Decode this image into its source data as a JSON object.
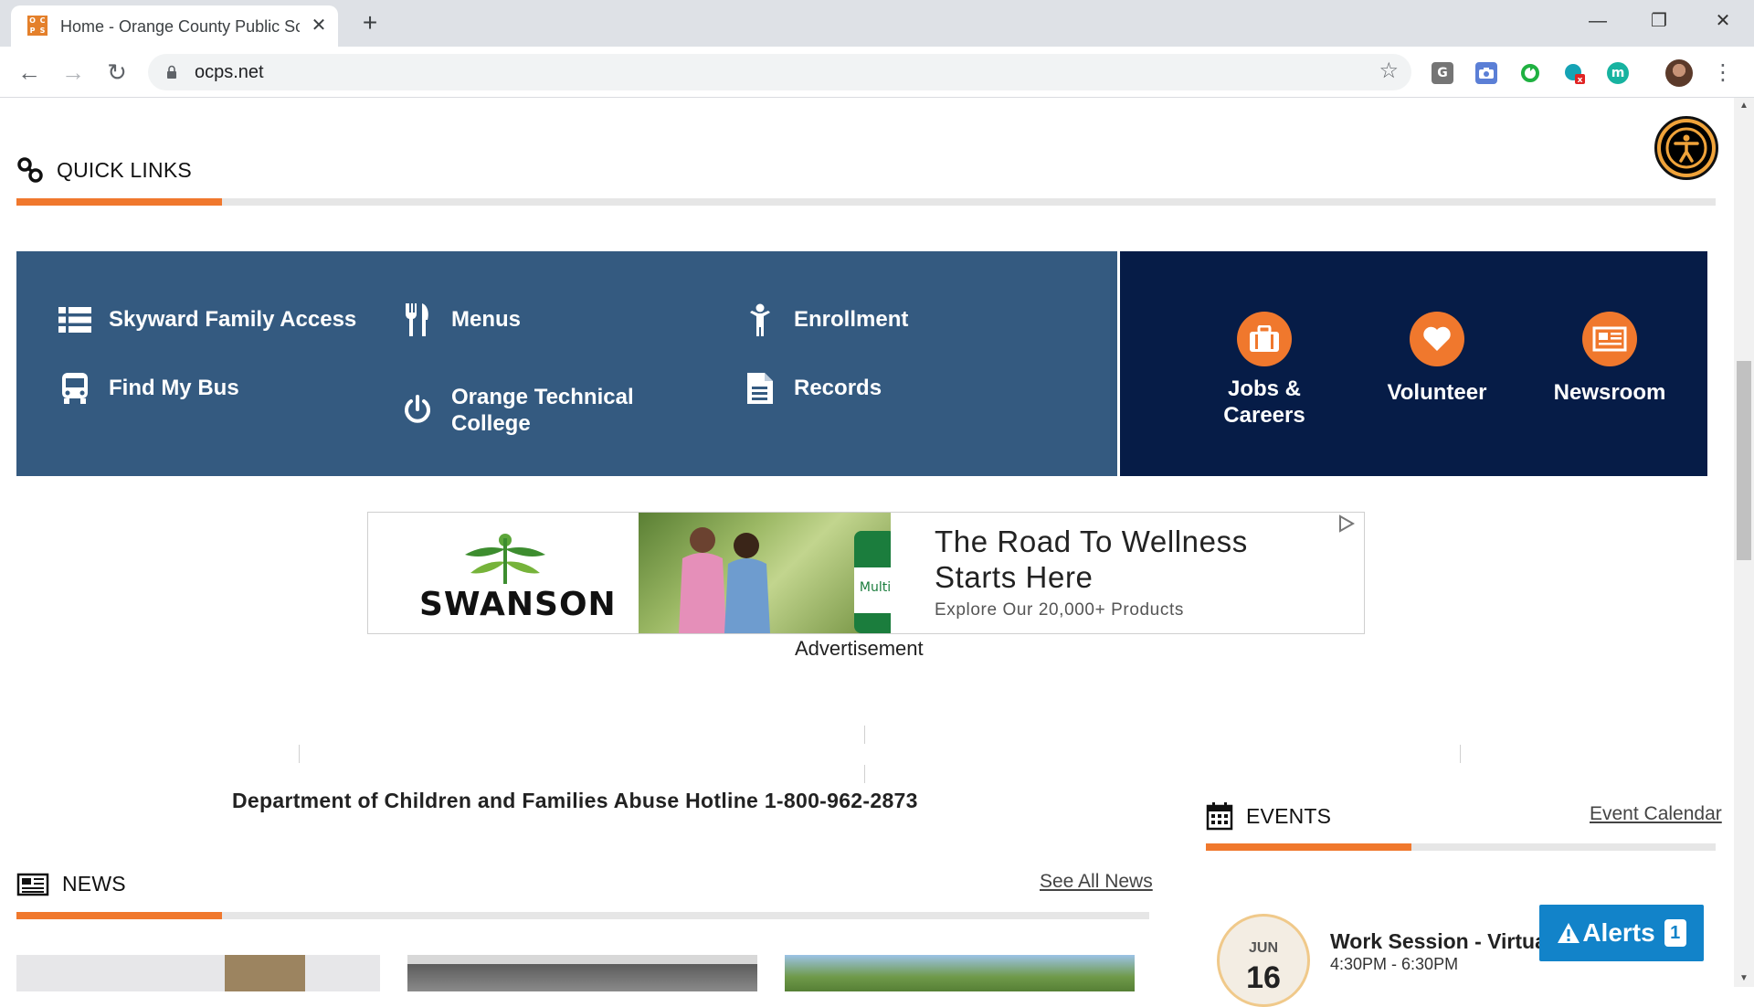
{
  "browser": {
    "tab_title": "Home - Orange County Public Schools",
    "favicon_letters": [
      "O",
      "C",
      "P",
      "S"
    ],
    "new_tab": "+",
    "tab_close": "✕",
    "url": "ocps.net",
    "ext_labels": [
      "G",
      "m"
    ],
    "window_controls": [
      "—",
      "❐",
      "✕"
    ],
    "nav": {
      "back": "←",
      "forward": "→",
      "reload": "↻"
    },
    "star": "☆",
    "menu": "⋮"
  },
  "quick_links": {
    "title": "QUICK LINKS",
    "items": [
      {
        "label": "Skyward Family Access",
        "icon": "list-icon"
      },
      {
        "label": "Menus",
        "icon": "fork-knife-icon"
      },
      {
        "label": "Enrollment",
        "icon": "child-icon"
      },
      {
        "label": "Find My Bus",
        "icon": "bus-icon"
      },
      {
        "label": "Orange Technical College",
        "icon": "power-icon"
      },
      {
        "label": "Records",
        "icon": "document-icon"
      }
    ],
    "featured": [
      {
        "label": "Jobs & Careers",
        "icon": "briefcase-icon"
      },
      {
        "label": "Volunteer",
        "icon": "heart-icon"
      },
      {
        "label": "Newsroom",
        "icon": "newspaper-icon"
      }
    ]
  },
  "ad": {
    "brand": "SWANSON",
    "product_label": "Multi",
    "headline_line1": "The Road To Wellness",
    "headline_line2": "Starts Here",
    "subtext": "Explore Our 20,000+ Products",
    "caption": "Advertisement"
  },
  "hotline": "Department of Children and Families Abuse Hotline 1-800-962-2873",
  "news": {
    "title": "NEWS",
    "see_all": "See All News"
  },
  "events": {
    "title": "EVENTS",
    "calendar_link": "Event Calendar",
    "items": [
      {
        "month": "JUN",
        "day": "16",
        "title": "Work Session - Virtual",
        "time": "4:30PM - 6:30PM"
      }
    ]
  },
  "alerts": {
    "label": "Alerts",
    "count": "1"
  },
  "colors": {
    "accent_orange": "#f0782d",
    "quicklinks_blue": "#345a80",
    "featured_navy": "#061c47",
    "alerts_blue": "#1283c9"
  }
}
